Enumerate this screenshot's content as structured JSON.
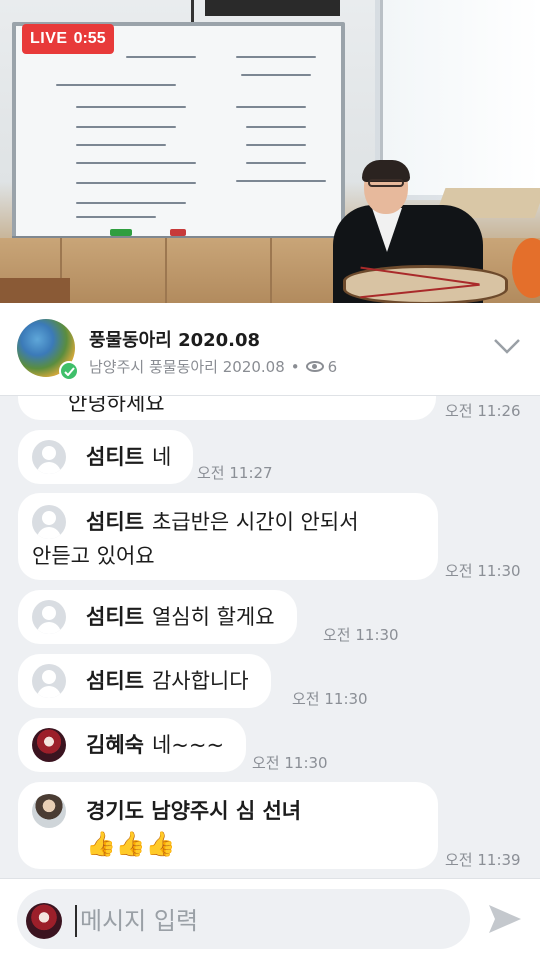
{
  "stream": {
    "live_label": "LIVE",
    "elapsed": "0:55"
  },
  "header": {
    "title": "풍물동아리 2020.08",
    "subtitle": "남양주시 풍물동아리 2020.08",
    "separator": "•",
    "viewers": "6"
  },
  "chat": {
    "messages": [
      {
        "nick": "",
        "text": "안녕하세요",
        "time": "오전 11:26",
        "avatar": "default-avatar",
        "partial": true
      },
      {
        "nick": "섬티트",
        "text": "네",
        "time": "오전 11:27",
        "avatar": "default-avatar"
      },
      {
        "nick": "섬티트",
        "text": "초급반은 시간이 안되서",
        "text2": "안듣고 있어요",
        "time": "오전 11:30",
        "avatar": "default-avatar"
      },
      {
        "nick": "섬티트",
        "text": "열심히 할게요",
        "time": "오전 11:30",
        "avatar": "default-avatar"
      },
      {
        "nick": "섬티트",
        "text": "감사합니다",
        "time": "오전 11:30",
        "avatar": "default-avatar"
      },
      {
        "nick": "김혜숙",
        "text": "네~~~",
        "time": "오전 11:30",
        "avatar": "profile-photo"
      },
      {
        "nick": "경기도 남양주시  심 선녀",
        "text": "👍👍👍",
        "time": "오전 11:39",
        "avatar": "profile-photo"
      }
    ]
  },
  "input": {
    "placeholder": "메시지 입력"
  },
  "icons": {
    "viewers": "eye-icon",
    "collapse": "chevron-down-icon",
    "send": "send-icon",
    "verified": "verified-badge-icon"
  },
  "colors": {
    "live_red": "#e83a3a",
    "verify_green": "#3fbf6a",
    "bubble_bg": "#ffffff",
    "chat_bg": "#eef0f3"
  }
}
